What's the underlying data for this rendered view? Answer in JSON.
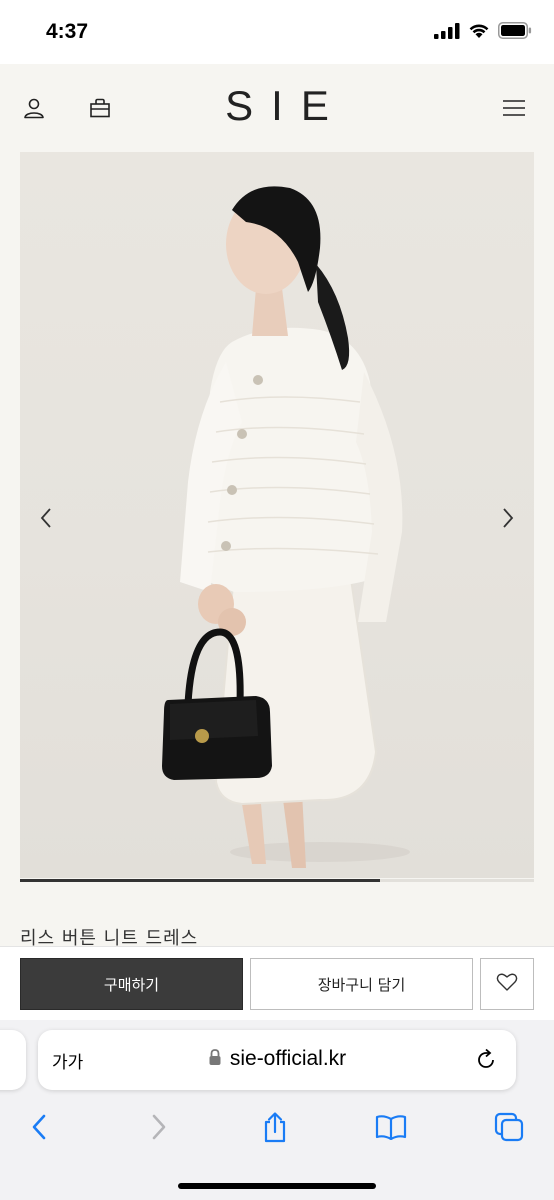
{
  "status_bar": {
    "time": "4:37"
  },
  "site": {
    "logo": "SIE"
  },
  "gallery": {
    "progress": 0.7
  },
  "product": {
    "name": "리스 버튼 니트 드레스"
  },
  "actions": {
    "buy_label": "구매하기",
    "cart_label": "장바구니 담기"
  },
  "browser": {
    "text_size_label": "가가",
    "url": "sie-official.kr"
  },
  "colors": {
    "page_bg": "#f6f5f1",
    "buy_button": "#3b3b3b",
    "ios_blue": "#1a7cf5"
  }
}
